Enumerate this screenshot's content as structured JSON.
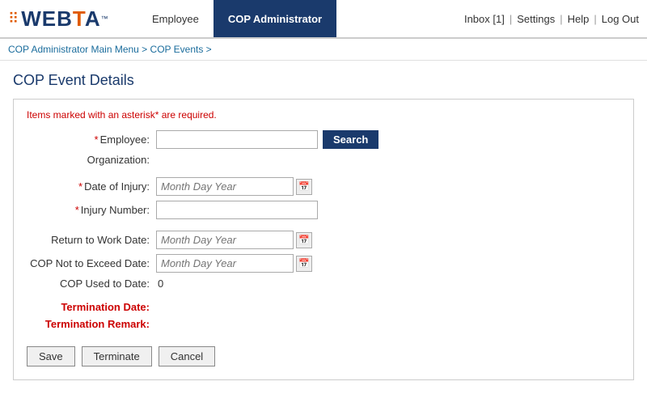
{
  "header": {
    "logo_text": "WEBTA",
    "logo_tm": "™",
    "nav_tabs": [
      {
        "label": "Employee",
        "active": false
      },
      {
        "label": "COP Administrator",
        "active": true
      }
    ],
    "inbox_label": "Inbox [1]",
    "settings_label": "Settings",
    "help_label": "Help",
    "logout_label": "Log Out"
  },
  "breadcrumb": {
    "part1": "COP Administrator Main Menu",
    "sep1": " > ",
    "part2": "COP Events",
    "sep2": " >"
  },
  "page": {
    "title": "COP Event Details"
  },
  "form": {
    "required_note_prefix": "Items marked with an asterisk",
    "required_star": "*",
    "required_note_suffix": " are required.",
    "employee_label": "Employee:",
    "search_button": "Search",
    "organization_label": "Organization:",
    "date_of_injury_label": "Date of Injury:",
    "date_placeholder": "Month Day Year",
    "injury_number_label": "Injury Number:",
    "return_to_work_label": "Return to Work Date:",
    "cop_not_exceed_label": "COP Not to Exceed Date:",
    "cop_used_label": "COP Used to Date:",
    "cop_used_value": "0",
    "termination_date_label": "Termination Date:",
    "termination_remark_label": "Termination Remark:",
    "cal_icon": "🗓"
  },
  "buttons": {
    "save": "Save",
    "terminate": "Terminate",
    "cancel": "Cancel"
  }
}
